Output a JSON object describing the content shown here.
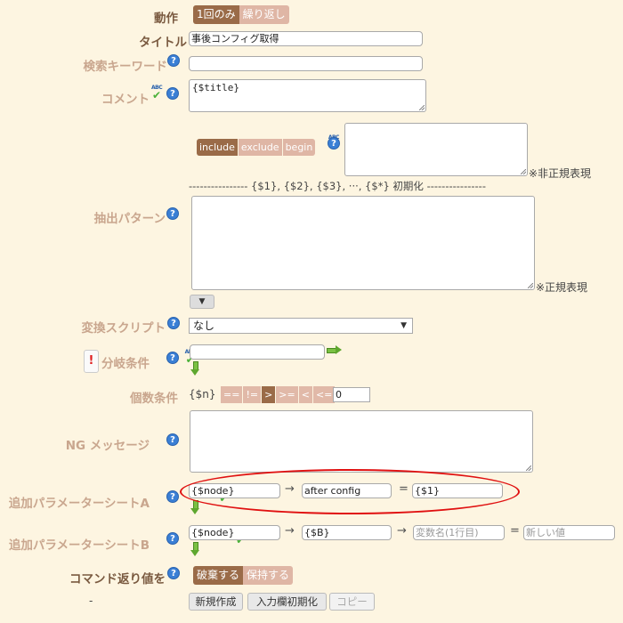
{
  "action": {
    "label": "動作",
    "options": [
      "1回のみ",
      "繰り返し"
    ],
    "selected": "1回のみ"
  },
  "title": {
    "label": "タイトル",
    "value": "事後コンフィグ取得"
  },
  "search_keyword": {
    "label": "検索キーワード",
    "value": ""
  },
  "comment": {
    "label": "コメント",
    "value": "{$title}"
  },
  "match_mode": {
    "options": [
      "include",
      "exclude",
      "begin"
    ],
    "selected": "include",
    "note": "※非正規表現"
  },
  "init_line": "---------------- {$1}, {$2}, {$3}, ···, {$*} 初期化 ----------------",
  "extract_pattern": {
    "label": "抽出パターン",
    "value": "",
    "note": "※正規表現",
    "toggle": "▼"
  },
  "convert_script": {
    "label": "変換スクリプト",
    "selected": "なし",
    "caret": "▼"
  },
  "branch_condition": {
    "label": "分岐条件",
    "value": "",
    "warn": "!"
  },
  "count_condition": {
    "label": "個数条件",
    "var": "{$n}",
    "ops": [
      "==",
      "!=",
      ">",
      ">=",
      "<",
      "<="
    ],
    "selected_op": ">",
    "value": "0"
  },
  "ng_message": {
    "label": "NG メッセージ",
    "value": ""
  },
  "param_sheet_a": {
    "label": "追加パラメーターシートA",
    "field1": "{$node}",
    "arrow1": "→",
    "field2": "after config",
    "eq": "=",
    "field3": "{$1}"
  },
  "param_sheet_b": {
    "label": "追加パラメーターシートB",
    "field1": "{$node}",
    "arrow1": "→",
    "field2": "{$B}",
    "arrow2": "→",
    "field3_placeholder": "変数名(1行目)",
    "eq": "=",
    "field4_placeholder": "新しい値"
  },
  "command_return": {
    "label": "コマンド返り値を",
    "options": [
      "破棄する",
      "保持する"
    ],
    "selected": "破棄する"
  },
  "footer": {
    "dash": "-",
    "new_button": "新規作成",
    "reset_button": "入力欄初期化",
    "copy_button": "コピー"
  },
  "icons": {
    "help": "?",
    "spellcheck_text": "ABC",
    "spellcheck_mark": "✔"
  },
  "colors": {
    "background": "#fdf5e1",
    "label": "#c9a68e",
    "label_dark": "#7a5a40",
    "toggle_on": "#9a6b48",
    "toggle_off": "#dfb6a5",
    "highlight_ellipse": "#e01010"
  }
}
